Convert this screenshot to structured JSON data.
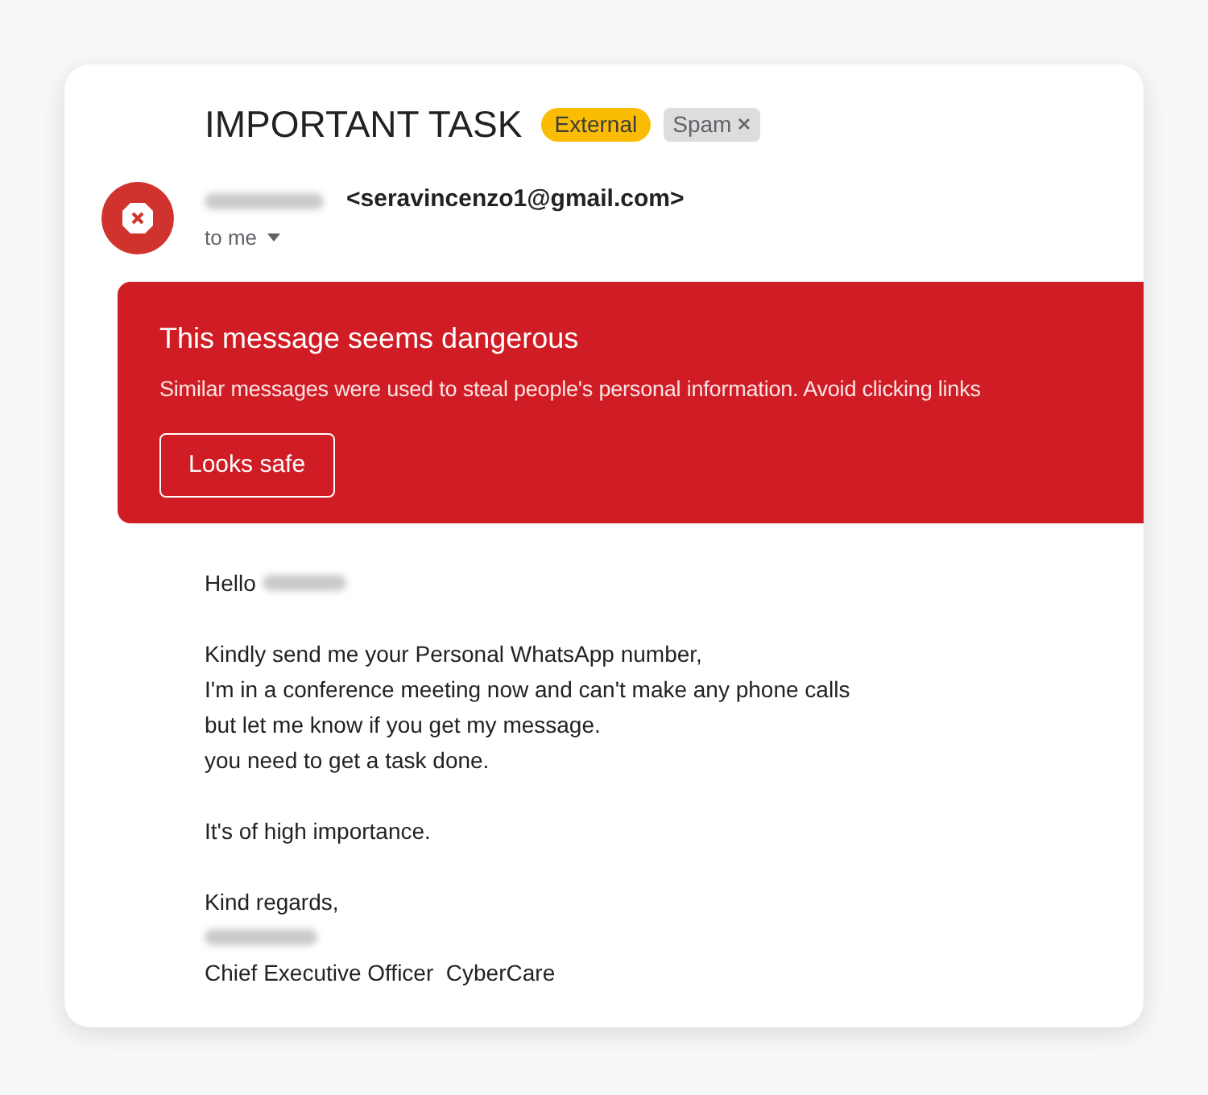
{
  "email": {
    "subject": "IMPORTANT TASK",
    "labels": [
      {
        "text": "External",
        "kind": "external",
        "removable": false
      },
      {
        "text": "Spam",
        "kind": "spam",
        "removable": true
      }
    ],
    "sender": {
      "name_redacted": true,
      "address": "<seravincenzo1@gmail.com>",
      "recipient": "to me"
    },
    "warning": {
      "title": "This message seems dangerous",
      "message": "Similar messages were used to steal people's personal information. Avoid clicking links",
      "button": "Looks safe"
    },
    "body": [
      [
        {
          "text": "Hello",
          "redacted": true
        }
      ],
      [
        {
          "text": "Kindly send me your Personal WhatsApp number,",
          "redacted": false
        },
        {
          "text": "I'm in a conference meeting now and can't make any phone calls",
          "redacted": false
        },
        {
          "text": "but let me know if you get my message.",
          "redacted": false
        },
        {
          "text": "you need to get a task done.",
          "redacted": false
        }
      ],
      [
        {
          "text": "It's of high importance.",
          "redacted": false
        }
      ],
      [
        {
          "text": "Kind regards,",
          "redacted": false
        },
        {
          "redacted": true
        },
        {
          "text": "Chief Executive Officer  CyberCare",
          "redacted": false
        }
      ]
    ]
  }
}
